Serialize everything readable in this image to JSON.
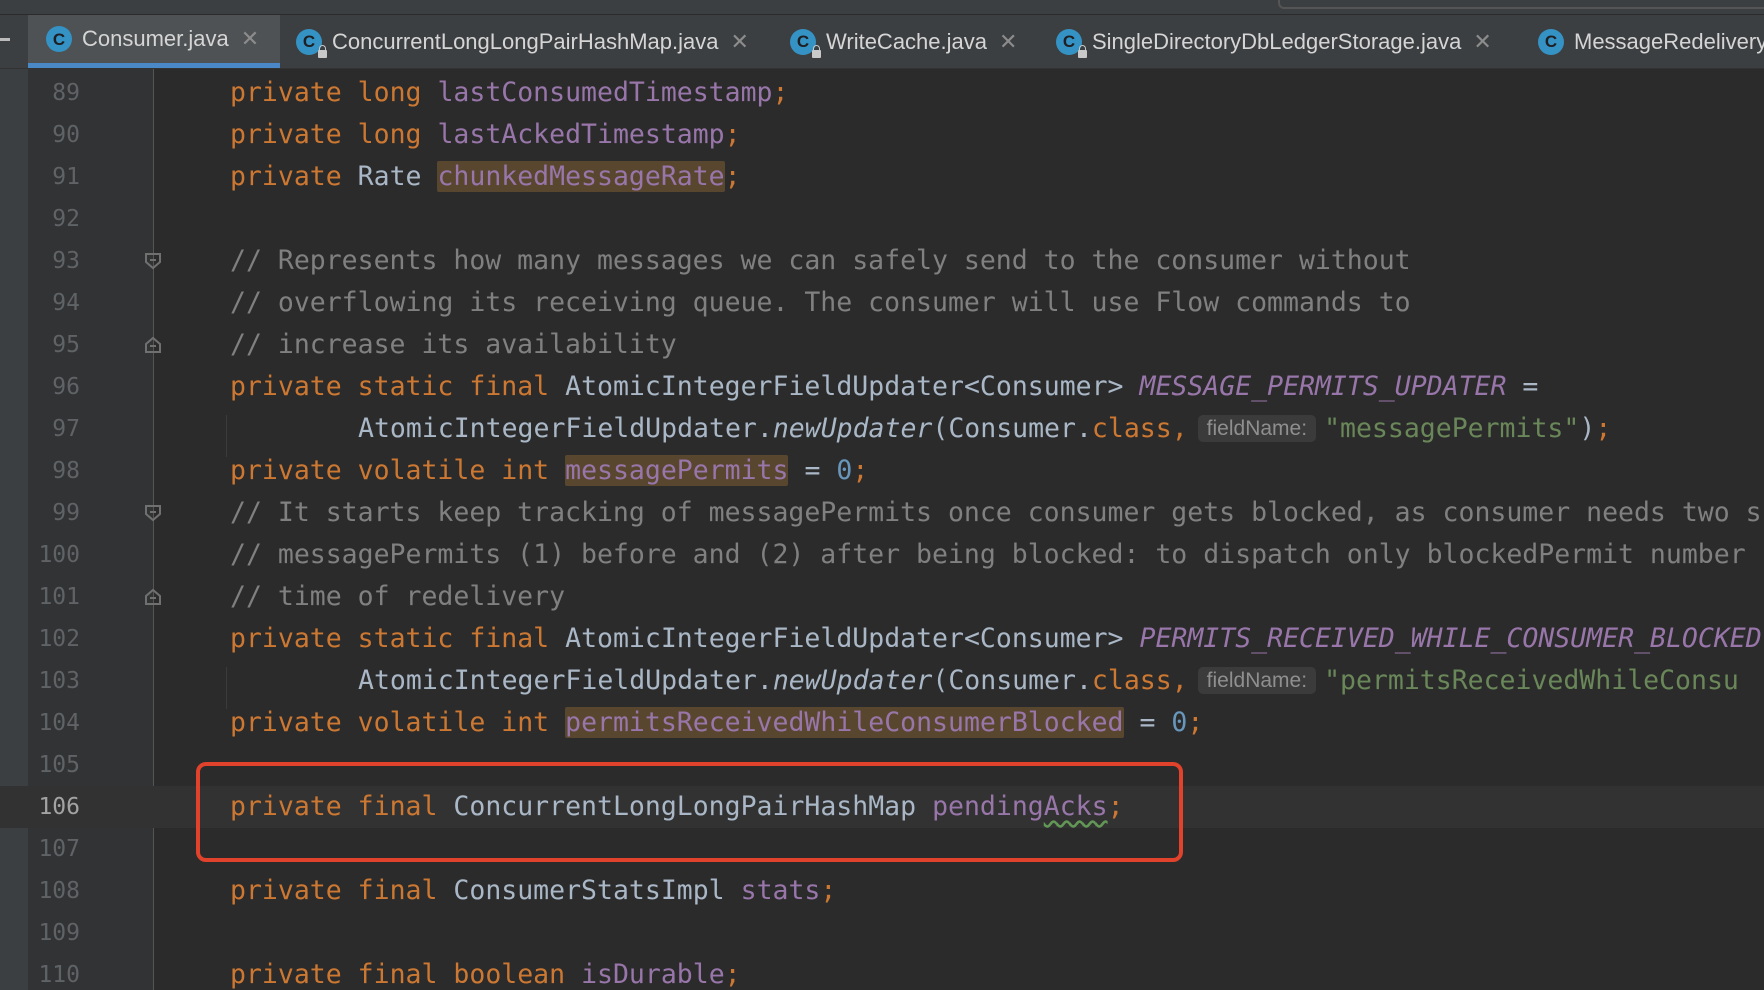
{
  "tabs": [
    {
      "label": "Consumer.java",
      "active": true,
      "closable": true,
      "locked": false
    },
    {
      "label": "ConcurrentLongLongPairHashMap.java",
      "active": false,
      "closable": true,
      "locked": true
    },
    {
      "label": "WriteCache.java",
      "active": false,
      "closable": true,
      "locked": true
    },
    {
      "label": "SingleDirectoryDbLedgerStorage.java",
      "active": false,
      "closable": true,
      "locked": true
    },
    {
      "label": "MessageRedelivery",
      "active": false,
      "closable": false,
      "locked": false
    }
  ],
  "file_icon_letter": "C",
  "close_glyph": "✕",
  "editor": {
    "current_line": "106",
    "highlighted_line": "106",
    "lines": [
      {
        "n": "89"
      },
      {
        "n": "90"
      },
      {
        "n": "91"
      },
      {
        "n": "92"
      },
      {
        "n": "93"
      },
      {
        "n": "94"
      },
      {
        "n": "95"
      },
      {
        "n": "96"
      },
      {
        "n": "97"
      },
      {
        "n": "98"
      },
      {
        "n": "99"
      },
      {
        "n": "100"
      },
      {
        "n": "101"
      },
      {
        "n": "102"
      },
      {
        "n": "103"
      },
      {
        "n": "104"
      },
      {
        "n": "105"
      },
      {
        "n": "106"
      },
      {
        "n": "107"
      },
      {
        "n": "108"
      },
      {
        "n": "109"
      },
      {
        "n": "110"
      }
    ],
    "tokens": {
      "private": "private",
      "long": "long",
      "static": "static",
      "final": "final",
      "volatile": "volatile",
      "int": "int",
      "boolean": "boolean",
      "class": "class",
      "l89_field": "lastConsumedTimestamp",
      "l90_a": "lastAcked",
      "l90_b": "Timestamp",
      "l91_type": "Rate",
      "l91_field": "chunkedMessageRate",
      "l93": "// Represents how many messages we can safely send to the consumer without",
      "l94": "// overflowing its receiving queue. The consumer will use Flow commands to",
      "l95": "// increase its availability",
      "l96_type": "AtomicIntegerFieldUpdater<Consumer>",
      "l96_const": "MESSAGE_PERMITS_UPDATER",
      "l97_cls": "AtomicIntegerFieldUpdater.",
      "l97_method": "newUpdater",
      "l97_arg": "(Consumer.",
      "hint_label": "fieldName:",
      "l97_str": "\"messagePermits\"",
      "l98_field": "messagePermits",
      "zero": "0",
      "l99": "// It starts keep tracking of messagePermits once consumer gets blocked, as consumer needs two s",
      "l100": "// messagePermits (1) before and (2) after being blocked: to dispatch only blockedPermit number",
      "l101": "// time of redelivery",
      "l102_const": "PERMITS_RECEIVED_WHILE_CONSUMER_BLOCKED",
      "l103_str": "\"permitsReceivedWhileConsu",
      "l104_field": "permitsReceivedWhileConsumerBlocked",
      "l106_type": "ConcurrentLongLongPairHashMap",
      "l106_a": "pending",
      "l106_b": "Acks",
      "l108_type": "ConsumerStatsImpl",
      "l108_field": "stats",
      "l110_field": "isDurable"
    }
  },
  "colors": {
    "keyword": "#cc7832",
    "field": "#9876aa",
    "comment": "#808080",
    "string": "#6a8759",
    "number": "#6897bb",
    "highlight_box": "#e0422c",
    "active_tab_underline": "#4a88c7"
  }
}
